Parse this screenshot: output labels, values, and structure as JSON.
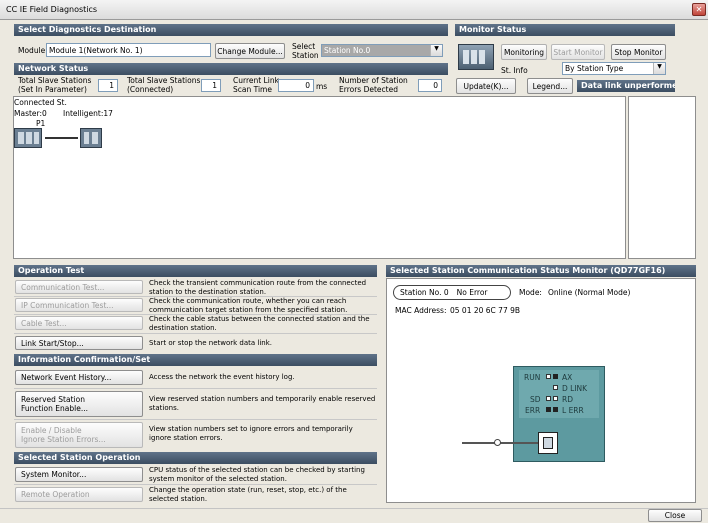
{
  "window": {
    "title": "CC IE Field Diagnostics"
  },
  "select_dest": {
    "header": "Select Diagnostics Destination",
    "module_label": "Module",
    "module_value": "Module 1(Network No. 1)",
    "change_module_label": "Change Module...",
    "select_station_label_1": "Select",
    "select_station_label_2": "Station",
    "station_value": "Station No.0"
  },
  "monitor_status": {
    "header": "Monitor Status",
    "status_text": "Monitoring",
    "start_label": "Start Monitor",
    "stop_label": "Stop Monitor",
    "st_info_label": "St. Info",
    "st_info_value": "By Station Type"
  },
  "network_status": {
    "header": "Network Status",
    "total_param_label_1": "Total Slave Stations",
    "total_param_label_2": "(Set In Parameter)",
    "total_param_value": "1",
    "total_connected_label_1": "Total Slave Stations",
    "total_connected_label_2": "(Connected)",
    "total_connected_value": "1",
    "scan_label_1": "Current Link",
    "scan_label_2": "Scan Time",
    "scan_value": "0",
    "scan_unit": "ms",
    "errors_label_1": "Number of Station",
    "errors_label_2": "Errors Detected",
    "errors_value": "0",
    "update_label": "Update(K)...",
    "legend_label": "Legend...",
    "data_link_text": "Data link unperformed"
  },
  "topology": {
    "connected_label": "Connected St.",
    "master_label": "Master:0",
    "intelligent_label": "Intelligent:17",
    "port_label": "P1"
  },
  "operation_test": {
    "header": "Operation Test",
    "items": [
      {
        "label": "Communication Test...",
        "desc": "Check the transient communication route from the connected station to the destination station."
      },
      {
        "label": "IP Communication Test...",
        "desc": "Check the communication route, whether you can reach communication target station from the specified station."
      },
      {
        "label": "Cable Test...",
        "desc": "Check the cable status between the connected station and the destination station."
      },
      {
        "label": "Link Start/Stop...",
        "desc": "Start or stop the network data link."
      }
    ]
  },
  "info_confirm": {
    "header": "Information Confirmation/Set",
    "items": [
      {
        "label": "Network Event History...",
        "desc": "Access the network the event history log."
      },
      {
        "label_1": "Reserved Station",
        "label_2": "Function Enable...",
        "desc": "View reserved station numbers and temporarily enable reserved stations."
      },
      {
        "label_1": "Enable / Disable",
        "label_2": "Ignore Station Errors...",
        "desc": "View station numbers set to ignore errors and temporarily ignore station errors."
      }
    ]
  },
  "selected_station_op": {
    "header": "Selected Station Operation",
    "items": [
      {
        "label": "System Monitor...",
        "desc": "CPU status of the selected station can be checked by starting system monitor of the selected station."
      },
      {
        "label": "Remote Operation",
        "desc": "Change the operation state (run, reset, stop, etc.) of the selected station."
      }
    ]
  },
  "comm_monitor": {
    "header": "Selected Station Communication Status Monitor (QD77GF16)",
    "station_text": "Station No. 0",
    "error_text": "No Error",
    "mode_label": "Mode:",
    "mode_value": "Online (Normal Mode)",
    "mac_label": "MAC Address:",
    "mac_value": "05 01 20 6C 77 9B",
    "leds": {
      "run": "RUN",
      "ax": "AX",
      "dlink": "D LINK",
      "sd": "SD",
      "rd": "RD",
      "err": "ERR",
      "lerr": "L ERR"
    }
  },
  "footer": {
    "close_label": "Close"
  }
}
